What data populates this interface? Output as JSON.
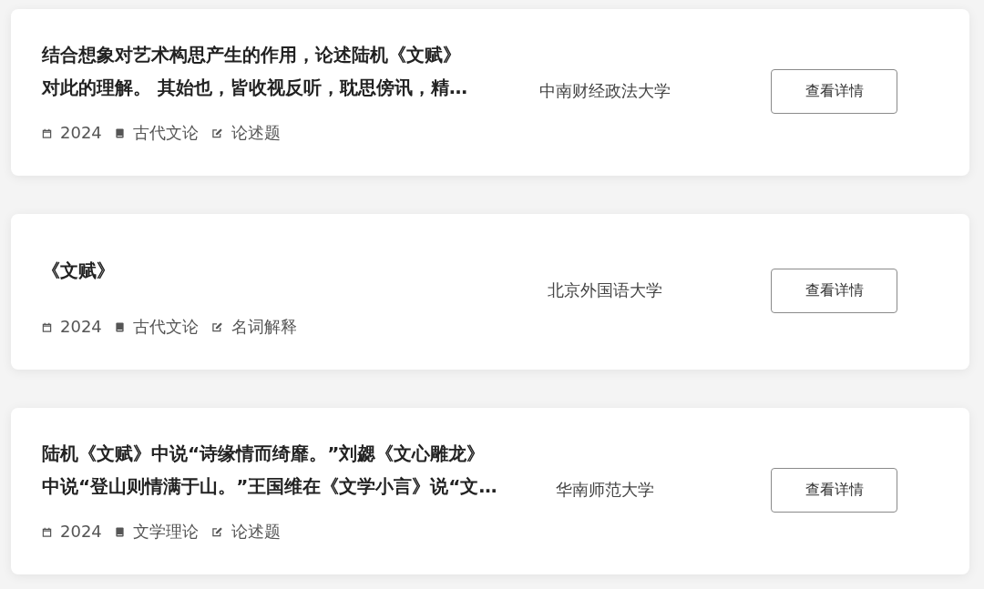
{
  "questions": [
    {
      "title_lines": [
        "结合想象对艺术构思产生的作用，论述陆机《文赋》",
        "对此的理解。 其始也，皆收视反听，耽思傍讯，精…"
      ],
      "year": "2024",
      "subject": "古代文论",
      "type": "论述题",
      "school": "中南财经政法大学",
      "button": "查看详情"
    },
    {
      "title_lines": [
        "《文赋》"
      ],
      "year": "2024",
      "subject": "古代文论",
      "type": "名词解释",
      "school": "北京外国语大学",
      "button": "查看详情"
    },
    {
      "title_lines": [
        "陆机《文赋》中说“诗缘情而绮靡。”刘勰《文心雕龙》",
        "中说“登山则情满于山。”王国维在《文学小言》说“文…"
      ],
      "year": "2024",
      "subject": "文学理论",
      "type": "论述题",
      "school": "华南师范大学",
      "button": "查看详情"
    }
  ]
}
